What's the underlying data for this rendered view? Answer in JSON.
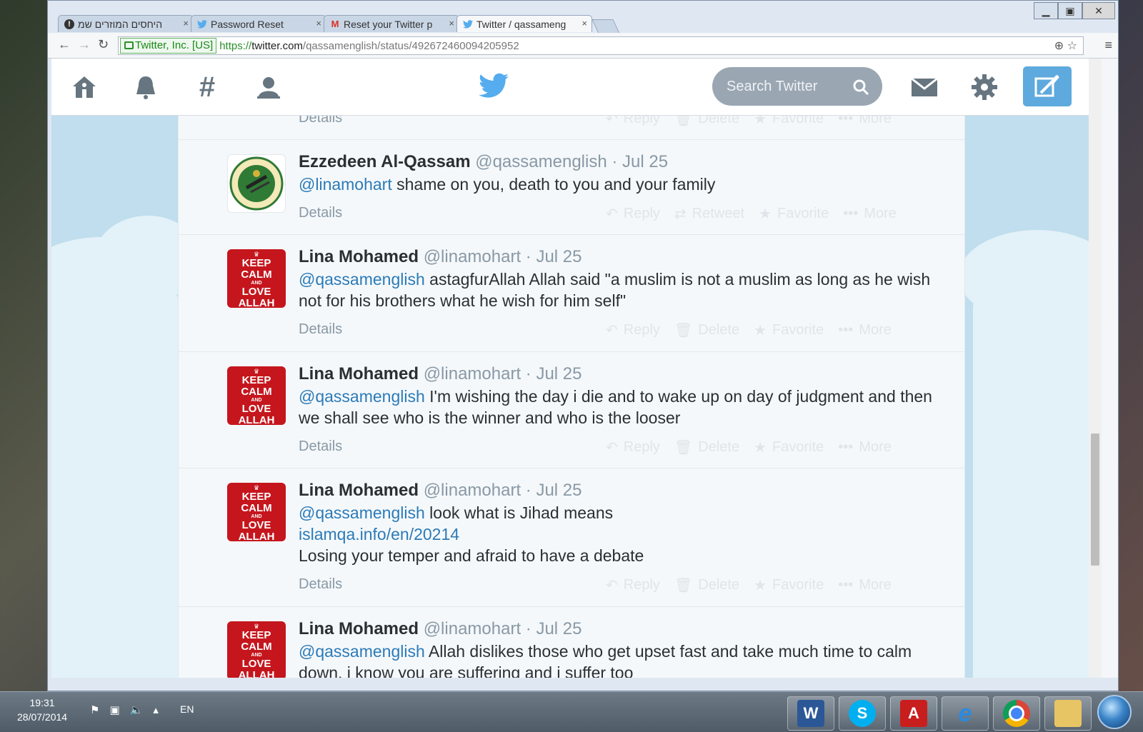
{
  "browser": {
    "tabs": [
      {
        "label": "היחסים המוזרים שמ",
        "icon": "info-icon"
      },
      {
        "label": "Password Reset",
        "icon": "twitter-bird-icon"
      },
      {
        "label": "Reset your Twitter p",
        "icon": "gmail-icon"
      },
      {
        "label": "Twitter / qassameng",
        "icon": "twitter-bird-icon",
        "active": true
      }
    ],
    "ev_certificate": "Twitter, Inc. [US]",
    "url_scheme": "https://",
    "url_host": "twitter.com",
    "url_path": "/qassamenglish/status/492672460094205952"
  },
  "twitter": {
    "search_placeholder": "Search Twitter",
    "accent_color": "#55acee"
  },
  "top_partial_tweet": {
    "details_label": "Details",
    "actions": [
      "Reply",
      "Delete",
      "Favorite",
      "More"
    ]
  },
  "tweets": [
    {
      "name": "Ezzedeen Al-Qassam",
      "handle": "@qassamenglish",
      "date": "· Jul 25",
      "avatar": "qassam-emblem",
      "mention": "@linamohart",
      "text": " shame on you, death to you and your family",
      "details_label": "Details",
      "actions": [
        "Reply",
        "Retweet",
        "Favorite",
        "More"
      ]
    },
    {
      "name": "Lina Mohamed",
      "handle": "@linamohart",
      "date": "· Jul 25",
      "avatar": "keep-calm",
      "mention": "@qassamenglish",
      "text": " astagfurAllah Allah said \"a muslim is not a muslim as long as he wish not for his brothers what he wish for him self\"",
      "details_label": "Details",
      "actions": [
        "Reply",
        "Delete",
        "Favorite",
        "More"
      ]
    },
    {
      "name": "Lina Mohamed",
      "handle": "@linamohart",
      "date": "· Jul 25",
      "avatar": "keep-calm",
      "mention": "@qassamenglish",
      "text": " I'm wishing the day i die and to wake up on day of judgment and then we shall see who is the winner and who is the looser",
      "details_label": "Details",
      "actions": [
        "Reply",
        "Delete",
        "Favorite",
        "More"
      ]
    },
    {
      "name": "Lina Mohamed",
      "handle": "@linamohart",
      "date": "· Jul 25",
      "avatar": "keep-calm",
      "mention": "@qassamenglish",
      "text": " look what is Jihad means",
      "link": "islamqa.info/en/20214",
      "text2": "Losing your temper and afraid to have a debate",
      "details_label": "Details",
      "actions": [
        "Reply",
        "Delete",
        "Favorite",
        "More"
      ]
    },
    {
      "name": "Lina Mohamed",
      "handle": "@linamohart",
      "date": "· Jul 25",
      "avatar": "keep-calm",
      "mention": "@qassamenglish",
      "text": " Allah dislikes those who get upset fast and take much time to calm down. i know you are suffering and i suffer too"
    }
  ],
  "avatar_text": {
    "line1": "KEEP",
    "line2": "CALM",
    "line3": "AND",
    "line4": "LOVE",
    "line5": "ALLAH"
  },
  "taskbar": {
    "time": "19:31",
    "date": "28/07/2014",
    "language": "EN",
    "apps": [
      "word-icon",
      "skype-icon",
      "acrobat-icon",
      "internet-explorer-icon",
      "chrome-icon",
      "file-explorer-icon"
    ]
  }
}
